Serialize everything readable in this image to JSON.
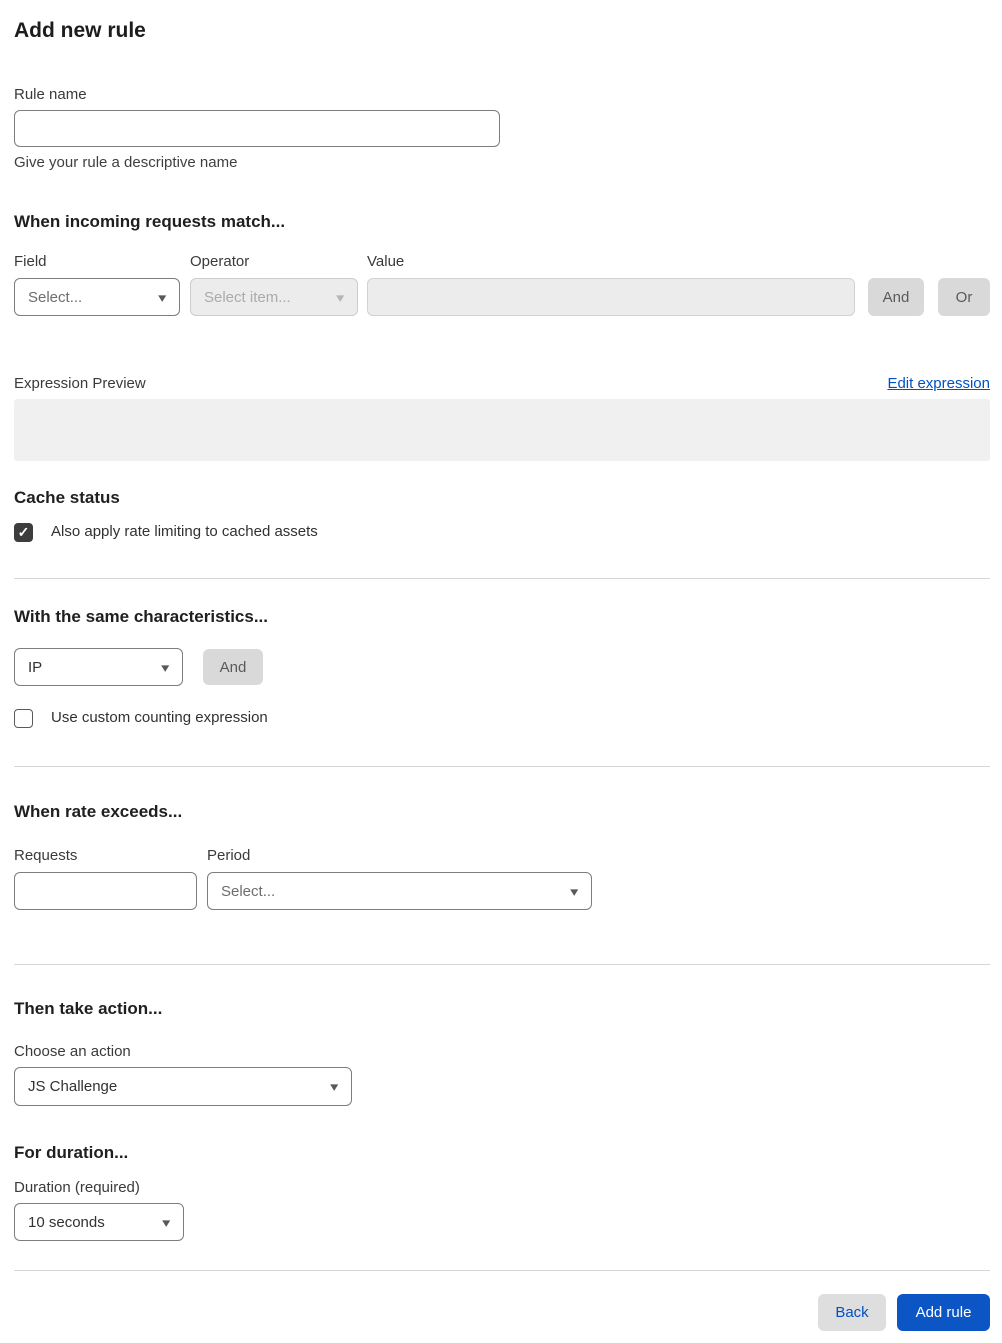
{
  "page": {
    "title": "Add new rule"
  },
  "colors": {
    "accent_blue": "#0051c3",
    "primary_button_bg": "#0b55c4",
    "gray_button_bg": "#d9d9d9",
    "disabled_field_bg": "#ececec",
    "preview_box_bg": "#f0f0f0",
    "checkbox_checked_bg": "#3d3d3d",
    "divider": "#d6d6d6"
  },
  "icons": {
    "chevron_down": "▾",
    "checkmark": "✓"
  },
  "rule_name": {
    "label": "Rule name",
    "value": "",
    "placeholder": "",
    "helper": "Give your rule a descriptive name"
  },
  "match": {
    "heading": "When incoming requests match...",
    "field": {
      "label": "Field",
      "selected": "Select..."
    },
    "operator": {
      "label": "Operator",
      "selected": "Select item...",
      "disabled": true
    },
    "value": {
      "label": "Value",
      "value": "",
      "disabled": true
    },
    "and_button": "And",
    "or_button": "Or",
    "expression_preview_label": "Expression Preview",
    "edit_expression_link": "Edit expression",
    "expression_value": ""
  },
  "cache_status": {
    "heading": "Cache status",
    "checkbox_label": "Also apply rate limiting to cached assets",
    "checked": true
  },
  "characteristics": {
    "heading": "With the same characteristics...",
    "selected": "IP",
    "and_button": "And",
    "checkbox_label": "Use custom counting expression",
    "checked": false
  },
  "rate": {
    "heading": "When rate exceeds...",
    "requests": {
      "label": "Requests",
      "value": ""
    },
    "period": {
      "label": "Period",
      "selected": "Select..."
    }
  },
  "action": {
    "heading": "Then take action...",
    "label": "Choose an action",
    "selected": "JS Challenge"
  },
  "duration": {
    "heading": "For duration...",
    "label": "Duration (required)",
    "selected": "10 seconds"
  },
  "footer": {
    "back_button": "Back",
    "add_rule_button": "Add rule"
  }
}
